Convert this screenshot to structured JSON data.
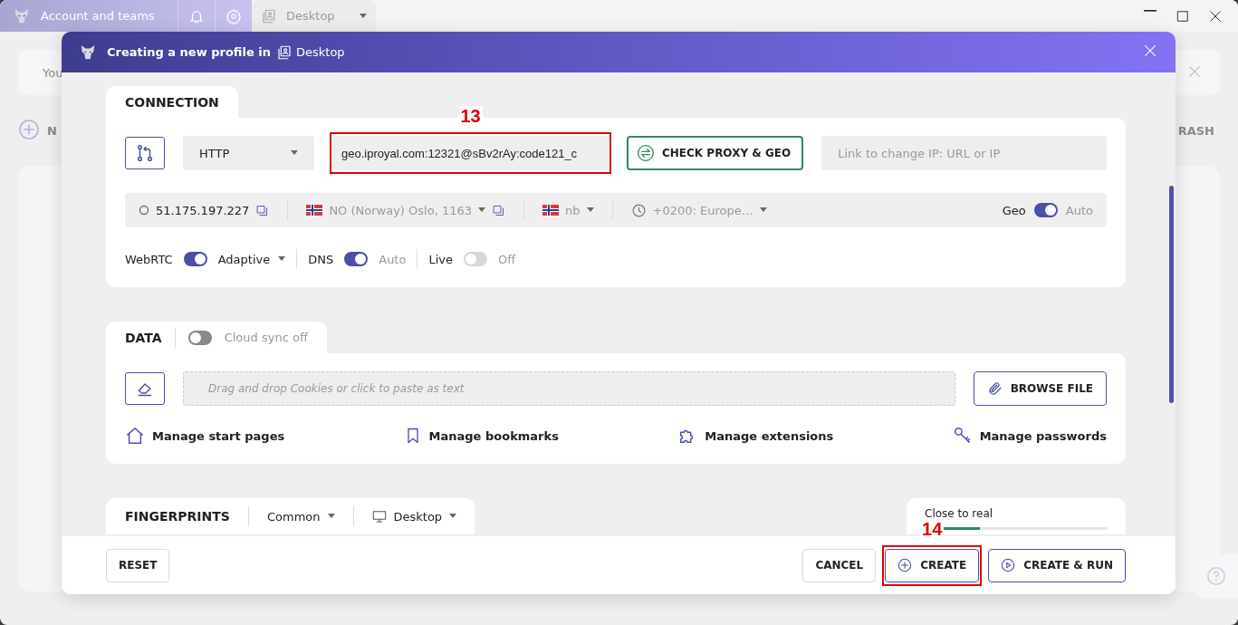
{
  "app_bar": {
    "account_label": "Account and teams",
    "workspace_tab": {
      "label": "Desktop"
    }
  },
  "background": {
    "banner_text": "You",
    "new_button": "N",
    "trash_button": "RASH"
  },
  "modal": {
    "title": "Creating a new profile in",
    "workspace": "Desktop"
  },
  "connection": {
    "heading": "CONNECTION",
    "proxy_type": "HTTP",
    "proxy_value": "geo.iproyal.com:12321@sBv2rAy:code121_c",
    "check_button": "CHECK PROXY & GEO",
    "change_ip_placeholder": "Link to change IP: URL or IP",
    "ip": "51.175.197.227",
    "location": "NO (Norway) Oslo, 1163",
    "language": "nb",
    "timezone": "+0200: Europe…",
    "geo": {
      "label": "Geo",
      "on": true,
      "mode": "Auto"
    },
    "toggles": [
      {
        "label": "WebRTC",
        "on": true,
        "mode": "Adaptive",
        "dropdown": true
      },
      {
        "label": "DNS",
        "on": true,
        "mode": "Auto",
        "dropdown": false
      },
      {
        "label": "Live",
        "on": false,
        "mode": "Off",
        "dropdown": false
      }
    ]
  },
  "data": {
    "heading": "DATA",
    "cloud_sync": {
      "on": false,
      "label": "Cloud sync off"
    },
    "drop_placeholder": "Drag and drop Cookies or click to paste as text",
    "browse_button": "BROWSE FILE",
    "links": [
      {
        "kind": "home",
        "label": "Manage start pages"
      },
      {
        "kind": "bookmark",
        "label": "Manage bookmarks"
      },
      {
        "kind": "puzzle",
        "label": "Manage extensions"
      },
      {
        "kind": "key",
        "label": "Manage passwords"
      }
    ]
  },
  "fingerprints": {
    "heading": "FINGERPRINTS",
    "preset": "Common",
    "device": "Desktop",
    "realism": {
      "label": "Close to real",
      "level": 0.3
    }
  },
  "footer": {
    "reset": "RESET",
    "cancel": "CANCEL",
    "create": "CREATE",
    "create_run": "CREATE & RUN"
  },
  "annotations": [
    {
      "label": "13"
    },
    {
      "label": "14"
    }
  ]
}
